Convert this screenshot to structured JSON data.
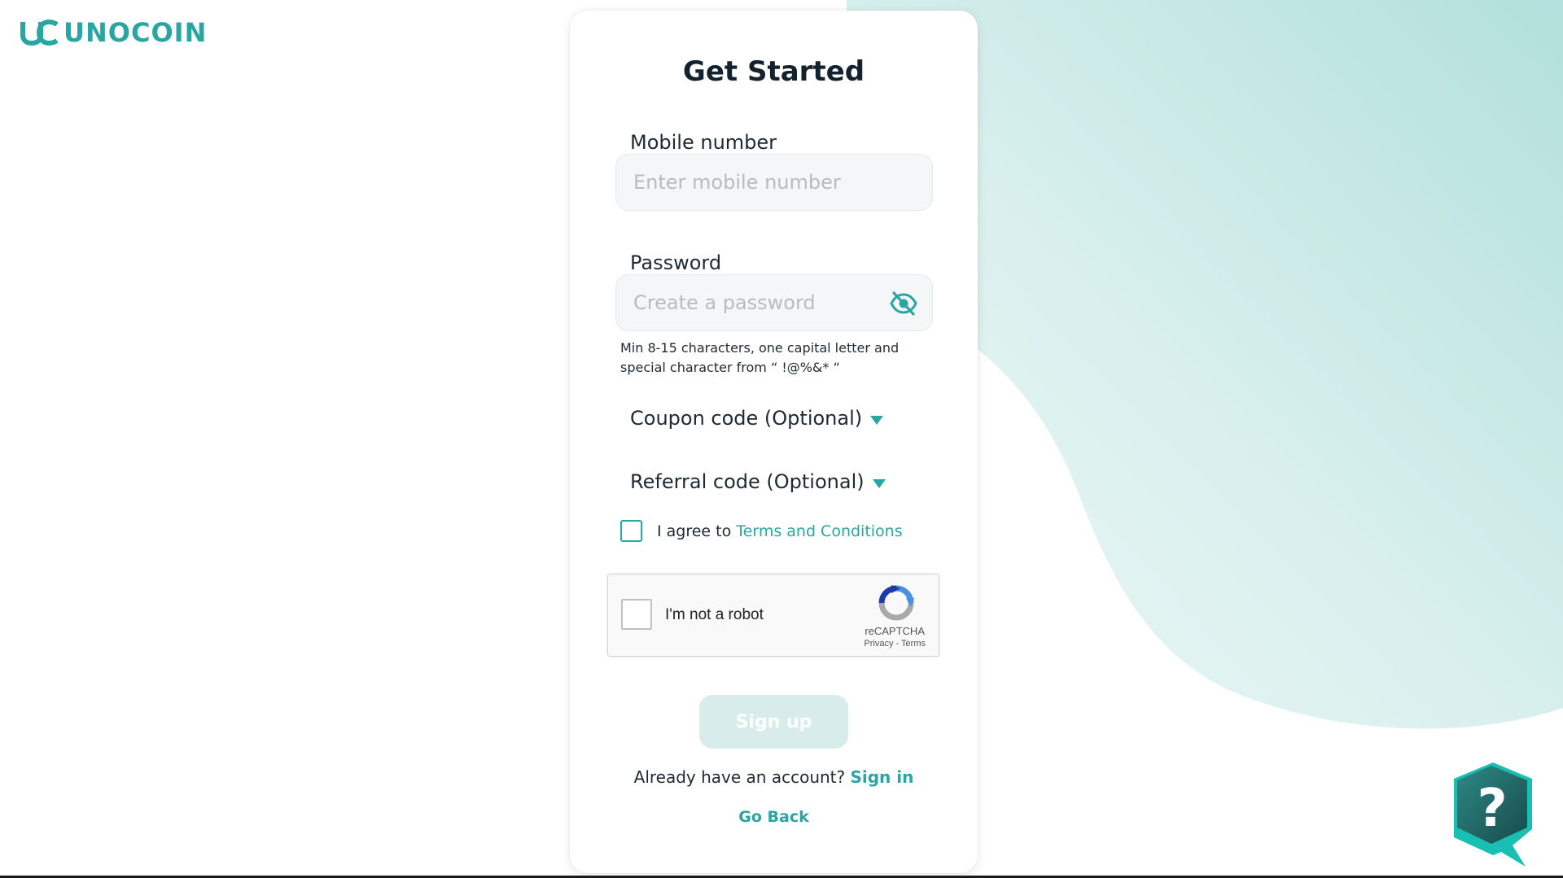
{
  "brand": {
    "name": "UNOCOIN"
  },
  "form": {
    "title": "Get Started",
    "mobile": {
      "label": "Mobile number",
      "placeholder": "Enter mobile number"
    },
    "password": {
      "label": "Password",
      "placeholder": "Create a password",
      "hint": "Min 8-15 characters, one capital letter and special character from “ !@%&* “"
    },
    "coupon_label": "Coupon code (Optional)",
    "referral_label": "Referral code (Optional)",
    "agree_prefix": "I agree to",
    "terms_link": "Terms and Conditions",
    "recaptcha": {
      "label": "I'm not a robot",
      "brand": "reCAPTCHA",
      "privacy": "Privacy",
      "separator": " - ",
      "terms": "Terms"
    },
    "signup_label": "Sign up",
    "have_account": "Already have an account?",
    "signin_link": "Sign in",
    "go_back": "Go Back"
  },
  "help": {
    "glyph": "?"
  },
  "colors": {
    "accent": "#2aa6a2",
    "dark": "#1f5d5c"
  }
}
